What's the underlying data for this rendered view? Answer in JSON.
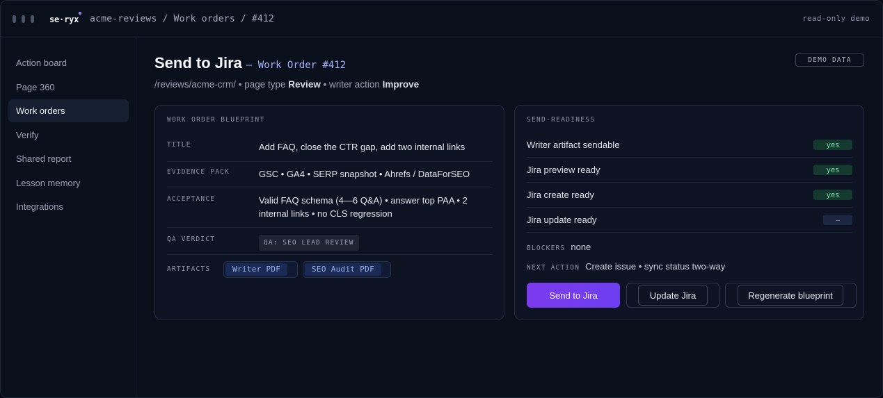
{
  "titlebar": {
    "logo": "se·ryx",
    "breadcrumb": "acme-reviews / Work orders / #412",
    "mode": "read-only demo"
  },
  "sidebar": {
    "items": [
      {
        "label": "Action board"
      },
      {
        "label": "Page 360"
      },
      {
        "label": "Work orders",
        "active": true
      },
      {
        "label": "Verify"
      },
      {
        "label": "Shared report"
      },
      {
        "label": "Lesson memory"
      },
      {
        "label": "Integrations"
      }
    ]
  },
  "header": {
    "title": "Send to Jira",
    "subtitle": "— Work Order #412",
    "badge": "DEMO DATA",
    "path": "/reviews/acme-crm/",
    "sep1": " • page type ",
    "page_type": "Review",
    "sep2": " • writer action ",
    "writer_action": "Improve"
  },
  "blueprint": {
    "heading": "WORK ORDER BLUEPRINT",
    "title_label": "TITLE",
    "title_value": "Add FAQ, close the CTR gap, add two internal links",
    "evidence_label": "EVIDENCE PACK",
    "evidence_value": "GSC • GA4 • SERP snapshot • Ahrefs / DataForSEO",
    "acceptance_label": "ACCEPTANCE",
    "acceptance_value": "Valid FAQ schema (4—6 Q&A) • answer top PAA • 2 internal links • no CLS regression",
    "qa_label": "QA VERDICT",
    "qa_value": "QA: SEO LEAD REVIEW",
    "artifacts_label": "ARTIFACTS",
    "artifacts": [
      "Writer PDF",
      "SEO Audit PDF"
    ]
  },
  "readiness": {
    "heading": "SEND-READINESS",
    "rows": [
      {
        "label": "Writer artifact sendable",
        "status": "yes"
      },
      {
        "label": "Jira preview ready",
        "status": "yes"
      },
      {
        "label": "Jira create ready",
        "status": "yes"
      },
      {
        "label": "Jira update ready",
        "status": "–"
      }
    ],
    "blockers_label": "BLOCKERS",
    "blockers_value": "none",
    "next_label": "NEXT ACTION",
    "next_value": "Create issue • sync status two-way",
    "buttons": {
      "send": "Send to Jira",
      "update": "Update Jira",
      "regenerate": "Regenerate blueprint"
    }
  },
  "colors": {
    "accent": "#7c3aed",
    "success": "#7ee0b0",
    "link": "#a5b4fc"
  }
}
